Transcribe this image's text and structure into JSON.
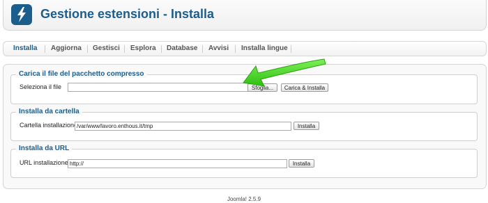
{
  "header": {
    "title": "Gestione estensioni - Installa",
    "logo_icon": "joomla-lightning-icon"
  },
  "tabs": [
    {
      "label": "Installa",
      "active": true
    },
    {
      "label": "Aggiorna",
      "active": false
    },
    {
      "label": "Gestisci",
      "active": false
    },
    {
      "label": "Esplora",
      "active": false
    },
    {
      "label": "Database",
      "active": false
    },
    {
      "label": "Avvisi",
      "active": false
    },
    {
      "label": "Installa lingue",
      "active": false
    }
  ],
  "upload": {
    "legend": "Carica il file del pacchetto compresso",
    "label": "Seleziona il file",
    "value": "",
    "browse_label": "Sfoglia...",
    "submit_label": "Carica & Installa"
  },
  "folder": {
    "legend": "Installa da cartella",
    "label": "Cartella installazione",
    "value": "/var/www/lavoro.enthous.it/tmp",
    "submit_label": "Installa"
  },
  "url": {
    "legend": "Installa da URL",
    "label": "URL installazione",
    "value": "http://",
    "submit_label": "Installa"
  },
  "annotation": {
    "icon": "green-arrow-icon",
    "color": "#3bd214"
  },
  "colors": {
    "accent": "#1b5d8c"
  },
  "footer": {
    "version": "Joomla! 2.5.9"
  }
}
